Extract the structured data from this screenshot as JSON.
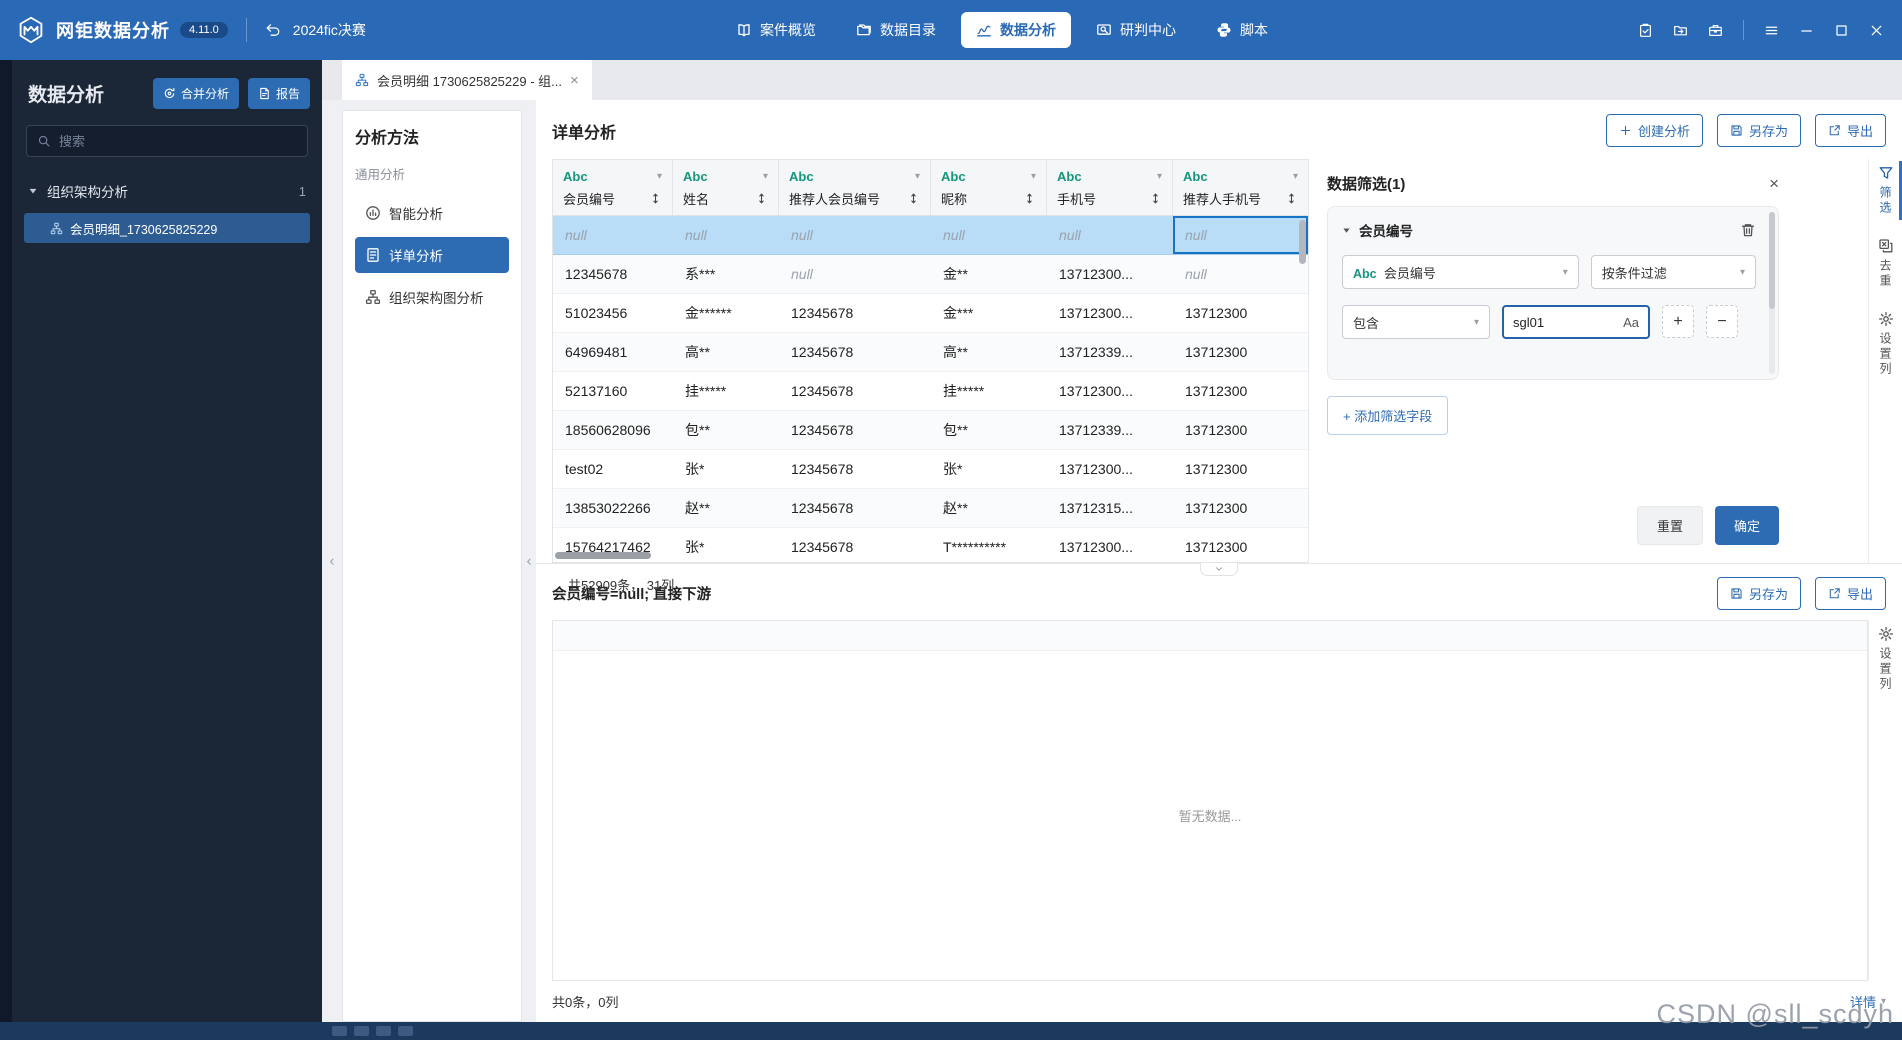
{
  "colors": {
    "accent": "#2d6cb3",
    "topbar": "#2a69b5",
    "sidebar": "#1b2637",
    "type_green": "#15967d",
    "selection": "#b9dcf7"
  },
  "topbar": {
    "app_title": "网钜数据分析",
    "version": "4.11.0",
    "project": "2024fic决赛",
    "nav": [
      {
        "id": "cases",
        "label": "案件概览",
        "icon": "book-icon",
        "active": false
      },
      {
        "id": "catalog",
        "label": "数据目录",
        "icon": "folder-icon",
        "active": false
      },
      {
        "id": "analysis",
        "label": "数据分析",
        "icon": "chart-icon",
        "active": true
      },
      {
        "id": "judge",
        "label": "研判中心",
        "icon": "screen-search-icon",
        "active": false
      },
      {
        "id": "script",
        "label": "脚本",
        "icon": "python-icon",
        "active": false
      }
    ]
  },
  "sidebar": {
    "title": "数据分析",
    "merge_button": "合并分析",
    "report_button": "报告",
    "search_placeholder": "搜索",
    "tree": {
      "group": "组织架构分析",
      "count": "1",
      "selected_item": "会员明细_1730625825229"
    }
  },
  "tab": {
    "label": "会员明细 1730625825229 - 组...",
    "close": "×"
  },
  "methods": {
    "title": "分析方法",
    "section": "通用分析",
    "items": [
      {
        "label": "智能分析",
        "icon": "smart-analysis-icon",
        "active": false
      },
      {
        "label": "详单分析",
        "icon": "detail-analysis-icon",
        "active": true
      },
      {
        "label": "组织架构图分析",
        "icon": "org-chart-icon",
        "active": false
      }
    ]
  },
  "detail": {
    "title": "详单分析",
    "actions": {
      "create": "创建分析",
      "save_as": "另存为",
      "export": "导出"
    },
    "table": {
      "columns": [
        {
          "type": "Abc",
          "name": "会员编号"
        },
        {
          "type": "Abc",
          "name": "姓名"
        },
        {
          "type": "Abc",
          "name": "推荐人会员编号"
        },
        {
          "type": "Abc",
          "name": "昵称"
        },
        {
          "type": "Abc",
          "name": "手机号"
        },
        {
          "type": "Abc",
          "name": "推荐人手机号"
        }
      ],
      "rows": [
        [
          "null",
          "null",
          "null",
          "null",
          "null",
          "null"
        ],
        [
          "12345678",
          "系***",
          "null",
          "金**",
          "13712300...",
          "null"
        ],
        [
          "51023456",
          "金******",
          "12345678",
          "金***",
          "13712300...",
          "13712300"
        ],
        [
          "64969481",
          "高**",
          "12345678",
          "高**",
          "13712339...",
          "13712300"
        ],
        [
          "52137160",
          "挂*****",
          "12345678",
          "挂*****",
          "13712300...",
          "13712300"
        ],
        [
          "18560628096",
          "包**",
          "12345678",
          "包**",
          "13712339...",
          "13712300"
        ],
        [
          "test02",
          "张*",
          "12345678",
          "张*",
          "13712300...",
          "13712300"
        ],
        [
          "13853022266",
          "赵**",
          "12345678",
          "赵**",
          "13712315...",
          "13712300"
        ],
        [
          "15764217462",
          "张*",
          "12345678",
          "T**********",
          "13712300...",
          "13712300"
        ]
      ],
      "selected_row": 0,
      "highlighted_row": 5,
      "active_cell": [
        0,
        5
      ]
    },
    "count_text": "共52909条， 31列"
  },
  "filter": {
    "title": "数据筛选(1)",
    "close": "×",
    "field_group": {
      "field_label": "会员编号",
      "field_select_type": "Abc",
      "field_select_value": "会员编号",
      "mode_select_value": "按条件过滤",
      "operator_select_value": "包含",
      "value_input": "sgl01",
      "case_toggle": "Aa",
      "add_condition": "+",
      "remove_condition": "−"
    },
    "add_field_button": "+ 添加筛选字段",
    "reset_button": "重置",
    "confirm_button": "确定"
  },
  "rail": {
    "filter": "筛选",
    "dedup": "去重",
    "columns": "设置列"
  },
  "bottom": {
    "title": "会员编号=null; 直接下游",
    "save_as": "另存为",
    "export": "导出",
    "empty_text": "暂无数据...",
    "count_text": "共0条，0列",
    "detail_toggle": "详情",
    "columns_tool": "设置列"
  },
  "watermark": "CSDN @sll_scdyh"
}
